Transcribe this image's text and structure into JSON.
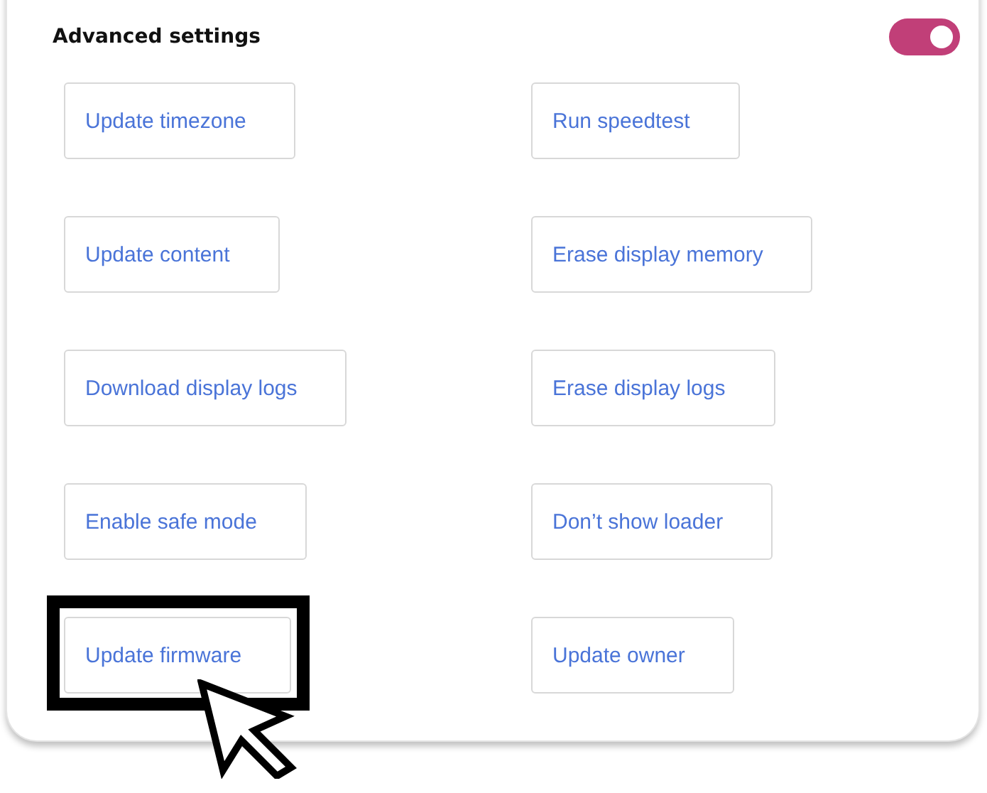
{
  "panel": {
    "title": "Advanced settings",
    "toggle": {
      "on": true
    }
  },
  "buttons": [
    {
      "label": "Update timezone",
      "highlighted": false
    },
    {
      "label": "Run speedtest",
      "highlighted": false
    },
    {
      "label": "Update content",
      "highlighted": false
    },
    {
      "label": "Erase display memory",
      "highlighted": false
    },
    {
      "label": "Download display logs",
      "highlighted": false
    },
    {
      "label": "Erase display logs",
      "highlighted": false
    },
    {
      "label": "Enable safe mode",
      "highlighted": false
    },
    {
      "label": "Don’t show loader",
      "highlighted": false
    },
    {
      "label": "Update firmware",
      "highlighted": true
    },
    {
      "label": "Update owner",
      "highlighted": false
    }
  ]
}
